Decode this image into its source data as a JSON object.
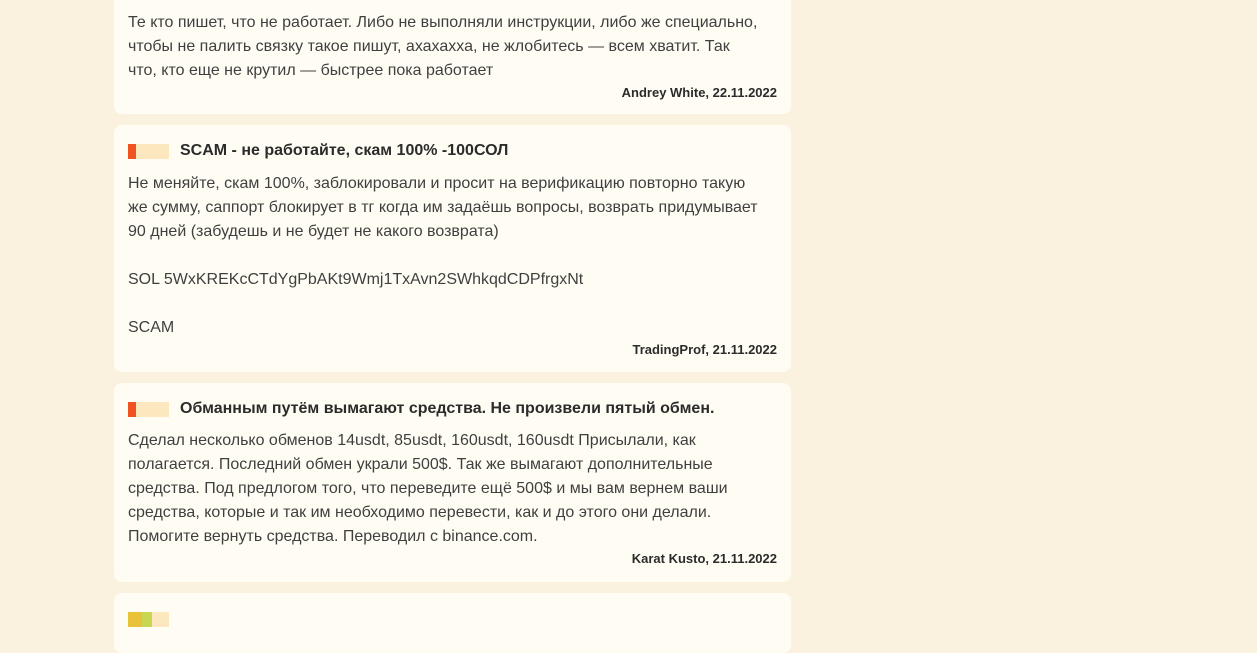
{
  "reviews": [
    {
      "title": "",
      "body": "Те кто пишет, что не работает. Либо не выполняли инструкции, либо же специально,\nчтобы не палить связку такое пишут, ахахахха, не жлобитесь — всем хватит. Так\nчто, кто еще не крутил — быстрее пока работает",
      "author_date": "Andrey White, 22.11.2022",
      "rating_color": "#f0531f"
    },
    {
      "title": "SCAM - не работайте, скам 100% -100СОЛ",
      "body": "Не меняйте, скам 100%, заблокировали и просит на верификацию повторно такую\nже сумму, саппорт блокирует в тг когда им задаёшь вопросы, возврать придумывает\n90 дней (забудешь и не будет не какого возврата)\n\nSOL 5WxKREKcCTdYgPbAKt9Wmj1TxAvn2SWhkqdCDPfrgxNt\n\nSCAM",
      "author_date": "TradingProf, 21.11.2022",
      "rating_color": "#f0531f"
    },
    {
      "title": "Обманным путём вымагают средства. Не произвели пятый обмен.",
      "body": "Сделал несколько обменов 14usdt, 85usdt, 160usdt, 160usdt Присылали, как\nполагается. Последний обмен украли 500$. Так же вымагают дополнительные\nсредства. Под предлогом того, что переведите ещё 500$ и мы вам вернем ваши\nсредства, которые и так им необходимо перевести, как и до этого они делали.\nПомогите вернуть средства. Переводил с binance.com.",
      "author_date": "Karat Kusto, 21.11.2022",
      "rating_color": "#f0531f"
    },
    {
      "title": "",
      "rating_color": "#e9c23a"
    }
  ]
}
